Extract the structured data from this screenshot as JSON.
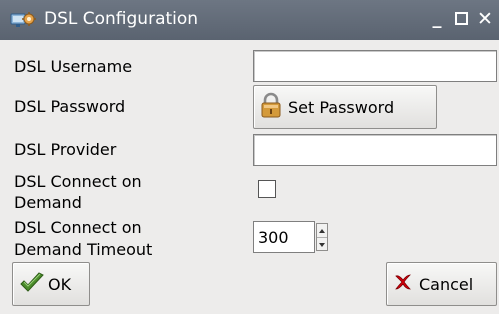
{
  "window": {
    "title": "DSL Configuration",
    "icon": "network-config-icon",
    "controls": {
      "minimize": "minimize-icon",
      "maximize": "maximize-icon",
      "close": "close-icon"
    }
  },
  "form": {
    "username": {
      "label": "DSL Username",
      "value": ""
    },
    "password": {
      "label": "DSL Password",
      "button_label": "Set Password",
      "button_icon": "padlock-icon"
    },
    "provider": {
      "label": "DSL Provider",
      "value": ""
    },
    "connect_on_demand": {
      "label_line1": "DSL Connect on",
      "label_line2": "Demand",
      "checked": false
    },
    "timeout": {
      "label_line1": "DSL Connect on",
      "label_line2": "Demand Timeout",
      "value": "300"
    }
  },
  "buttons": {
    "ok": {
      "label": "OK",
      "icon": "checkmark-icon"
    },
    "cancel": {
      "label": "Cancel",
      "icon": "red-x-icon"
    }
  },
  "colors": {
    "titlebar": "#5f6875",
    "background": "#edeceb",
    "cancel_icon": "#d9000a",
    "ok_icon": "#4a8c2a",
    "lock_icon": "#d49a3a"
  }
}
